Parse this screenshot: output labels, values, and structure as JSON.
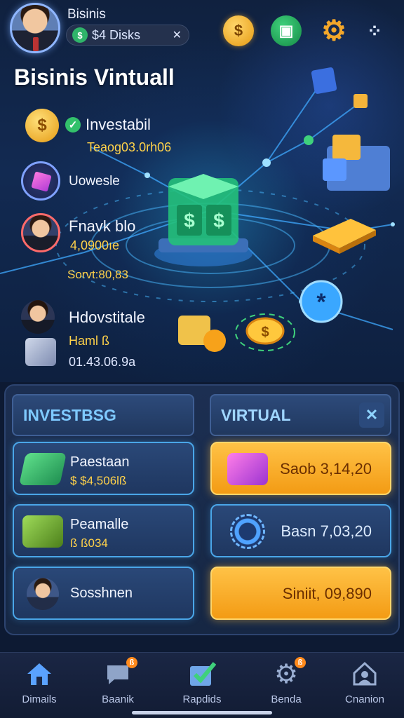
{
  "header": {
    "user_name": "Bisinis",
    "wallet_icon": "wallet-icon",
    "wallet_value": "$4 Disks",
    "chevron": "✕",
    "page_title": "Bisinis Vintuall"
  },
  "top_icons": [
    "coin-icon",
    "document-icon",
    "gear-icon",
    "share-icon"
  ],
  "stats": [
    {
      "label": "Investabil",
      "value": "Teaog03.0rh06"
    },
    {
      "label": "Uowesle"
    },
    {
      "label": "Fnavk blo",
      "value": "4,0900ıe",
      "extra": "Sorvt:80,83"
    },
    {
      "label": "Hdovstitale",
      "value": "Haml ß",
      "extra": "01.43.06.9a"
    }
  ],
  "tabs": {
    "left": "INVESTBSG",
    "right": "VIRTUAL",
    "close": "✕"
  },
  "cards_left": [
    {
      "title": "Paestaan",
      "value": "$ $4,506lß"
    },
    {
      "title": "Peamalle",
      "value": "ß ß034"
    },
    {
      "title": "Sosshnen"
    }
  ],
  "cards_right": [
    {
      "amount": "Saob 3,14,20"
    },
    {
      "amount": "Basn 7,03,20"
    },
    {
      "amount": "Siniit, 09,890"
    }
  ],
  "nav": [
    {
      "label": "Dimails",
      "icon": "home-icon"
    },
    {
      "label": "Baanik",
      "icon": "chat-icon",
      "badge": "ß"
    },
    {
      "label": "Rapdids",
      "icon": "check-box-icon"
    },
    {
      "label": "Benda",
      "icon": "gear-icon",
      "badge": "ß"
    },
    {
      "label": "Cnanion",
      "icon": "profile-icon"
    }
  ],
  "colors": {
    "background": "#0d1a33",
    "accent_gold": "#f39b14",
    "accent_blue": "#4aa6e8",
    "text_gold": "#ffd24a"
  }
}
